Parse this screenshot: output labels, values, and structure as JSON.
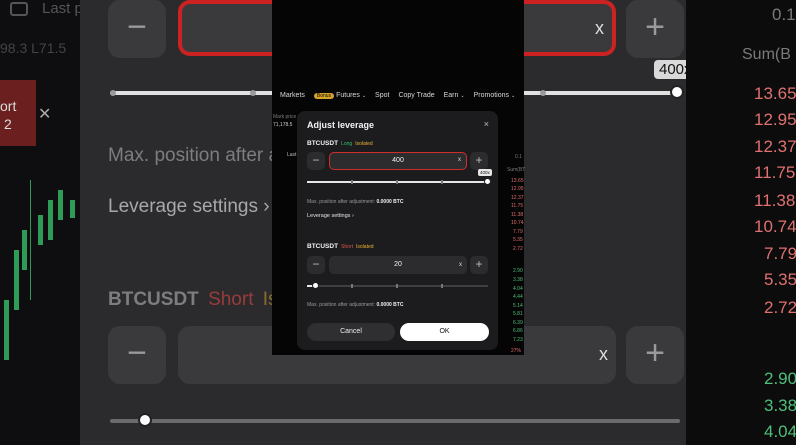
{
  "bg": {
    "price": "Last p",
    "price_value": "98.3 L71.5",
    "short_tag": "ort",
    "short_tag2": "2",
    "x_mark": "✕",
    "top_input_x": "x",
    "leverage_badge": "400x",
    "sum_label": "Sum(B",
    "top_right_num": "0.1",
    "max_position_text": "Max. position after a",
    "leverage_settings_text": "Leverage settings",
    "leverage_settings_chev": "›",
    "pair_text": "BTCUSDT",
    "short_text": "Short",
    "isolated_text": "Iso",
    "bottom_input_x": "x",
    "red_nums": [
      "13.65",
      "12.95",
      "12.37",
      "11.75",
      "11.38",
      "10.74",
      "7.79",
      "5.35",
      "2.72"
    ],
    "green_nums": [
      "2.90",
      "3.38",
      "4.04"
    ],
    "minus": "−",
    "plus": "+"
  },
  "nav": {
    "items": [
      "Markets",
      "Futures",
      "Spot",
      "Copy Trade",
      "Earn",
      "Promotions"
    ],
    "futures_badge": "Bonus"
  },
  "mini": {
    "mark": "Mark price",
    "mark_val": "71,178.5",
    "last": "Last",
    "sum": "Sum(BT",
    "val_0": "0.1",
    "red": [
      "13.65",
      "12.95",
      "12.37",
      "11.75",
      "11.38",
      "10.74",
      "7.79",
      "5.35",
      "2.72"
    ],
    "green": [
      "2.90",
      "3.38",
      "4.04",
      "4.44",
      "5.14",
      "5.81",
      "6.39",
      "6.86",
      "7.23"
    ],
    "pct": "27%"
  },
  "dialog": {
    "title": "Adjust leverage",
    "close": "×",
    "long": {
      "pair": "BTCUSDT",
      "side": "Long",
      "mode": "Isolated",
      "value": "400",
      "clear": "x",
      "minus": "−",
      "plus": "+",
      "tooltip": "400x",
      "level_fraction": 1.0,
      "max_label": "Max. position after adjustment:",
      "max_value": "0.0000 BTC"
    },
    "leverage_settings": "Leverage settings",
    "leverage_settings_chev": "›",
    "short": {
      "pair": "BTCUSDT",
      "side": "Short",
      "mode": "Isolated",
      "value": "20",
      "clear": "x",
      "minus": "−",
      "plus": "+",
      "level_fraction": 0.05,
      "max_label": "Max. position after adjustment:",
      "max_value": "0.0000 BTC"
    },
    "cancel": "Cancel",
    "ok": "OK"
  },
  "colors": {
    "accent_red": "#d12d2d",
    "long_green": "#2fbf71",
    "short_red": "#e0514f",
    "isolated_yellow": "#e8b233"
  }
}
